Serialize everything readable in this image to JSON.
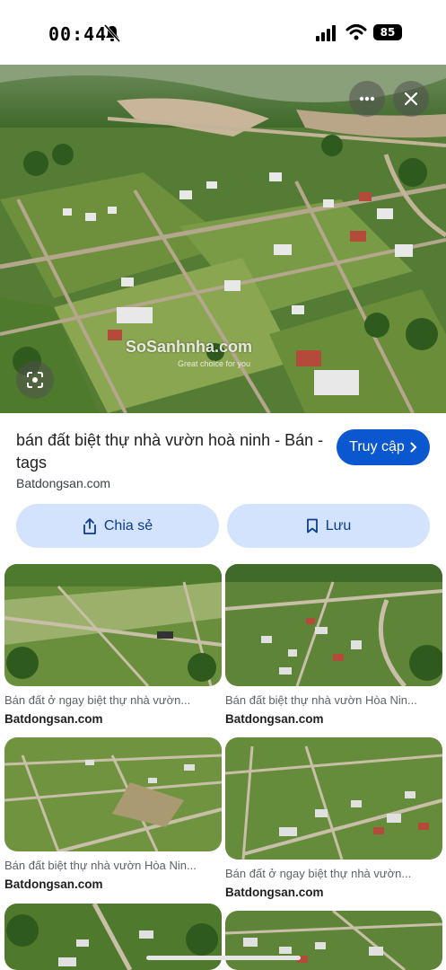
{
  "status_bar": {
    "time": "00:44",
    "battery": "85"
  },
  "hero": {
    "watermark": "SoSanhnha.com",
    "watermark_sub": "Great choice for you"
  },
  "detail": {
    "title": "bán đất biệt thự nhà vườn hoà ninh - Bán - tags",
    "source": "Batdongsan.com",
    "visit_label": "Truy cập",
    "share_label": "Chia sẻ",
    "save_label": "Lưu"
  },
  "results": [
    {
      "title": "Bán đất ở ngay biệt thự nhà vườn...",
      "source": "Batdongsan.com"
    },
    {
      "title": "Bán đất biệt thự nhà vườn Hòa Nin...",
      "source": "Batdongsan.com"
    },
    {
      "title": "Bán đất biệt thự nhà vườn Hòa Nin...",
      "source": "Batdongsan.com"
    },
    {
      "title": "Bán đất ở ngay biệt thự nhà vườn...",
      "source": "Batdongsan.com"
    },
    {
      "title": "",
      "source": ""
    },
    {
      "title": "",
      "source": ""
    }
  ],
  "colors": {
    "accent": "#0b57d0",
    "chip_bg": "#d3e3fd",
    "land_green": "#4f7a2e",
    "soil": "#b7a17a"
  },
  "icons": [
    "bell-slash-icon",
    "signal-icon",
    "wifi-icon",
    "battery-icon",
    "more-icon",
    "close-icon",
    "lens-icon",
    "chevron-right-icon",
    "share-icon",
    "bookmark-icon"
  ]
}
